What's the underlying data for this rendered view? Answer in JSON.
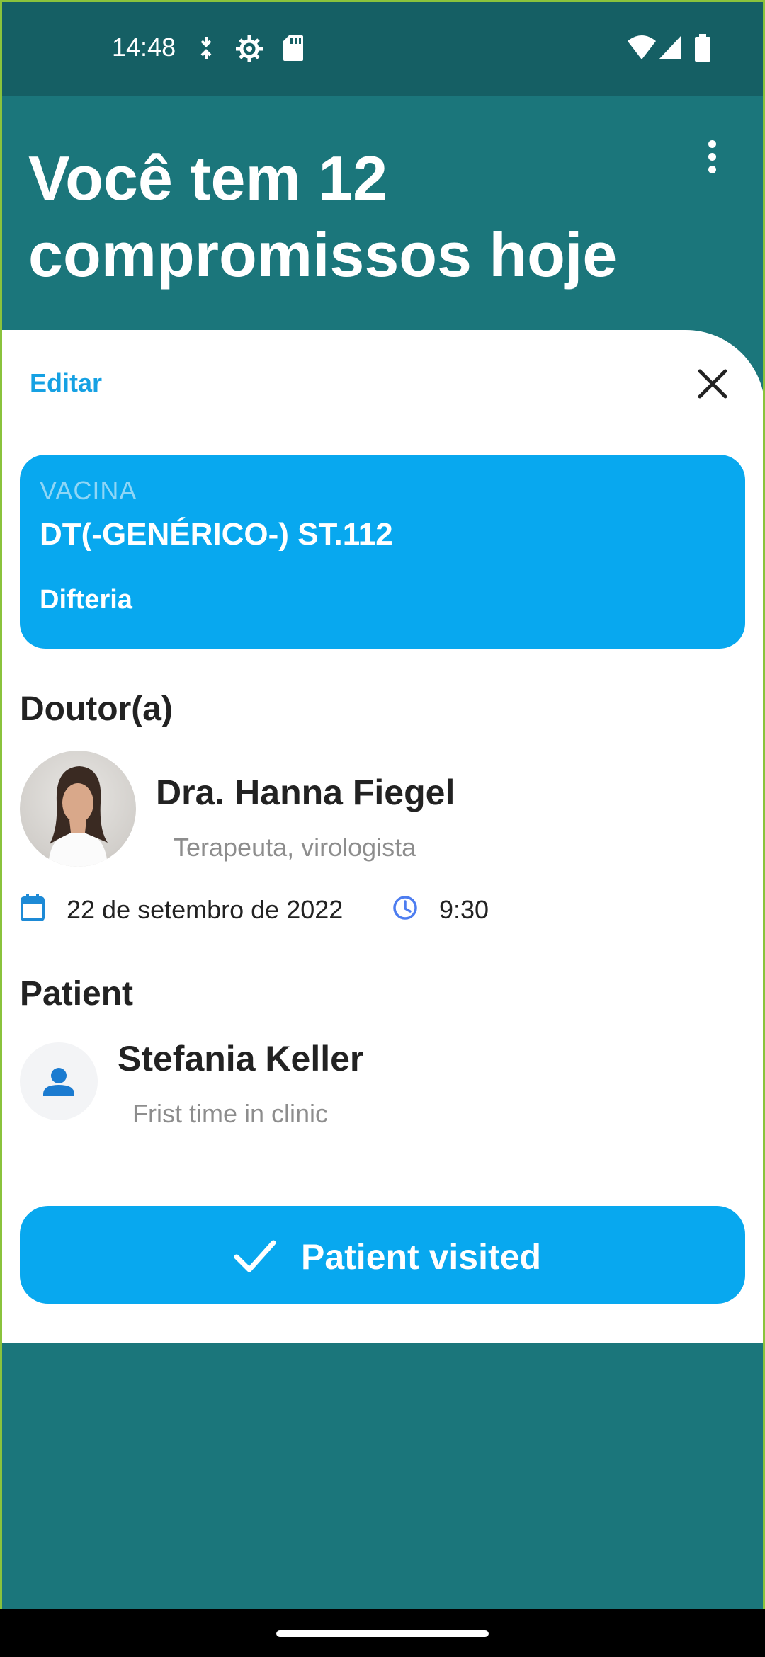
{
  "status_bar": {
    "time": "14:48",
    "icons_left": [
      "sync-icon",
      "settings-gear-icon",
      "sd-card-icon"
    ],
    "icons_right": [
      "wifi-icon",
      "signal-icon",
      "battery-icon"
    ]
  },
  "header": {
    "title": "Você tem 12 compromissos hoje",
    "menu_icon": "more-vert-icon"
  },
  "sheet": {
    "edit_label": "Editar",
    "close_icon": "close-icon",
    "vaccine": {
      "label": "VACINA",
      "name": "DT(-GENÉRICO-) ST.112",
      "disease": "Difteria"
    },
    "doctor_section_title": "Doutor(a)",
    "doctor": {
      "name": "Dra. Hanna Fiegel",
      "specialty": "Terapeuta, virologista"
    },
    "date": "22 de setembro de 2022",
    "time": "9:30",
    "patient_section_title": "Patient",
    "patient": {
      "name": "Stefania Keller",
      "note": "Frist time in clinic"
    },
    "action_button_label": "Patient visited"
  },
  "colors": {
    "background": "#1b767b",
    "status_bar": "#155f64",
    "accent": "#08a8ef",
    "edit_link": "#16a1e3"
  }
}
